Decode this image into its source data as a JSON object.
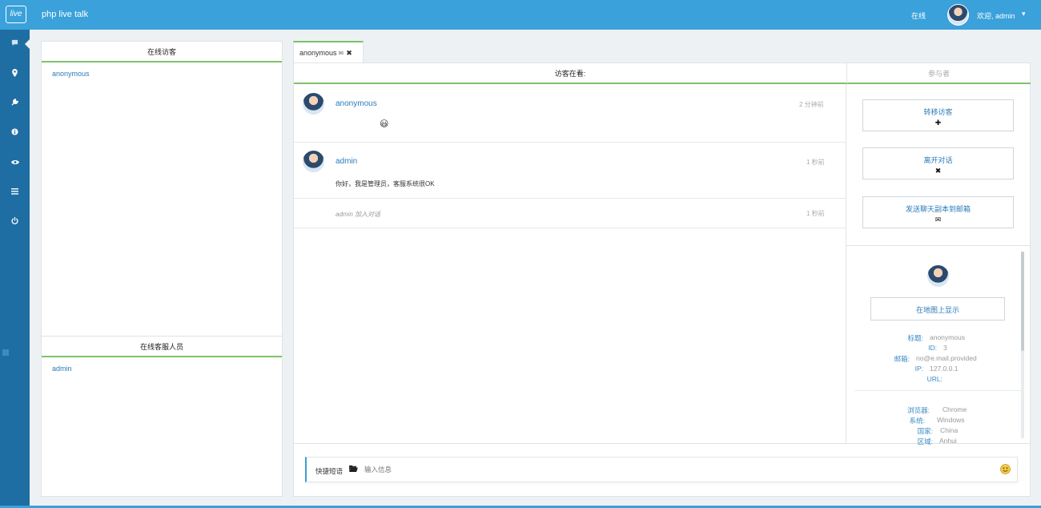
{
  "header": {
    "logo_text": "live",
    "app_title": "php live talk",
    "status": "在线",
    "welcome": "欢迎, admin",
    "caret": "⌄"
  },
  "sidebar": {
    "icons": [
      "chat-icon",
      "map-marker-icon",
      "wrench-icon",
      "info-icon",
      "eye-icon",
      "list-icon",
      "power-icon"
    ]
  },
  "online_visitors": {
    "title": "在线访客",
    "items": [
      "anonymous"
    ]
  },
  "online_staff": {
    "title": "在线客服人员",
    "items": [
      "admin"
    ]
  },
  "chat": {
    "tab_label": "anonymous",
    "visitor_viewing_label": "访客在看:",
    "participants_label": "参与者",
    "messages": [
      {
        "name": "anonymous",
        "time": "2 分钟前",
        "text": "😃"
      },
      {
        "name": "admin",
        "time": "1 秒前",
        "text": "你好，我是管理员，客服系统很OK"
      }
    ],
    "system_message": {
      "text": "admin 加入对话",
      "time": "1 秒前"
    },
    "input": {
      "quick_reply_label": "快捷短语",
      "placeholder": "输入信息"
    }
  },
  "actions": {
    "transfer": "转移访客",
    "leave": "离开对话",
    "send_transcript": "发送聊天副本到邮箱",
    "show_map": "在地图上显示"
  },
  "visitor_info": {
    "labels": {
      "title": "标题:",
      "id": "ID:",
      "email": "邮箱:",
      "ip": "IP:",
      "url": "URL:",
      "browser": "浏览器:",
      "os": "系统:",
      "country": "国家:",
      "region": "区域:"
    },
    "values": {
      "title": "anonymous",
      "id": "3",
      "email": "no@e.mail.provided",
      "ip": "127.0.0.1",
      "url": "",
      "browser": "Chrome",
      "os": "Windows",
      "country": "China",
      "region": "Anhui"
    }
  },
  "colors": {
    "primary": "#3aa1da",
    "sidebar": "#1f6ea3",
    "accent_green": "#7cc36a",
    "link": "#2b7bb9"
  }
}
